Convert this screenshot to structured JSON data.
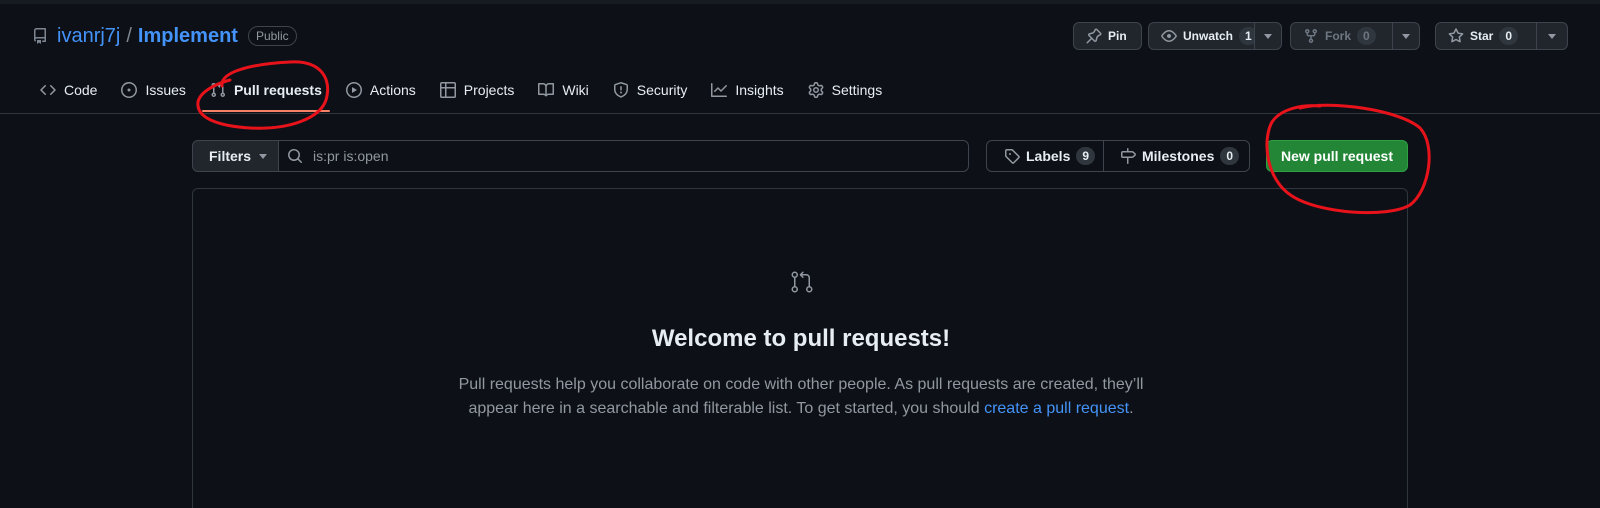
{
  "repo": {
    "owner": "ivanrj7j",
    "separator": "/",
    "name": "Implement",
    "visibility": "Public"
  },
  "actions": {
    "pin": "Pin",
    "unwatch": "Unwatch",
    "unwatch_count": "1",
    "fork": "Fork",
    "fork_count": "0",
    "star": "Star",
    "star_count": "0"
  },
  "tabs": [
    {
      "label": "Code",
      "icon": "code-icon"
    },
    {
      "label": "Issues",
      "icon": "issue-opened-icon"
    },
    {
      "label": "Pull requests",
      "icon": "git-pull-request-icon",
      "active": true
    },
    {
      "label": "Actions",
      "icon": "play-icon"
    },
    {
      "label": "Projects",
      "icon": "table-icon"
    },
    {
      "label": "Wiki",
      "icon": "book-icon"
    },
    {
      "label": "Security",
      "icon": "shield-icon"
    },
    {
      "label": "Insights",
      "icon": "graph-icon"
    },
    {
      "label": "Settings",
      "icon": "gear-icon"
    }
  ],
  "subnav": {
    "filters": "Filters",
    "search_value": "is:pr is:open",
    "labels": "Labels",
    "labels_count": "9",
    "milestones": "Milestones",
    "milestones_count": "0",
    "new_pr": "New pull request"
  },
  "blankslate": {
    "title": "Welcome to pull requests!",
    "desc_before": "Pull requests help you collaborate on code with other people. As pull requests are created, they’ll appear here in a searchable and filterable list. To get started, you should ",
    "desc_link": "create a pull request",
    "desc_after": "."
  },
  "colors": {
    "background": "#0d1117",
    "link": "#4493f8",
    "primary_button": "#238636",
    "active_tab_underline": "#f78166",
    "annotation": "#e8121b"
  }
}
